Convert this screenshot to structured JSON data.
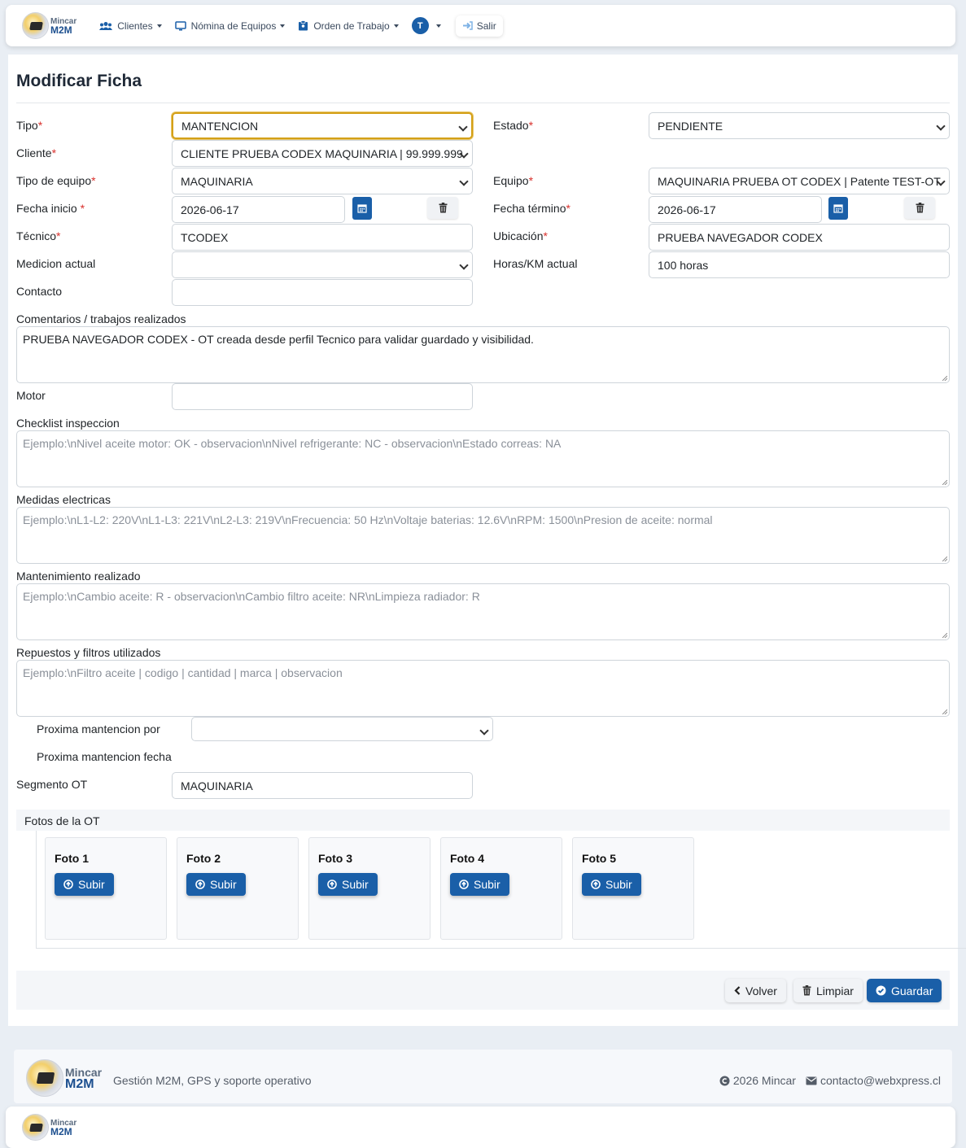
{
  "brand": {
    "line1": "Mincar",
    "line2": "M2M"
  },
  "nav": {
    "clientes": "Clientes",
    "nomina": "Nómina de Equipos",
    "orden": "Orden de Trabajo",
    "user_initial": "T",
    "salir": "Salir"
  },
  "page": {
    "title": "Modificar Ficha"
  },
  "form": {
    "tipo": {
      "label": "Tipo",
      "value": "MANTENCION"
    },
    "estado": {
      "label": "Estado",
      "value": "PENDIENTE"
    },
    "cliente": {
      "label": "Cliente",
      "value": "CLIENTE PRUEBA CODEX MAQUINARIA | 99.999.999"
    },
    "tipo_equipo": {
      "label": "Tipo de equipo",
      "value": "MAQUINARIA"
    },
    "equipo": {
      "label": "Equipo",
      "value": "MAQUINARIA PRUEBA OT CODEX | Patente TEST-OT"
    },
    "fecha_inicio": {
      "label": "Fecha inicio ",
      "value": "2026-06-17"
    },
    "fecha_termino": {
      "label": "Fecha término",
      "value": "2026-06-17"
    },
    "tecnico": {
      "label": "Técnico",
      "value": "TCODEX"
    },
    "ubicacion": {
      "label": "Ubicación",
      "value": "PRUEBA NAVEGADOR CODEX"
    },
    "medicion": {
      "label": "Medicion actual",
      "value": ""
    },
    "horas": {
      "label": "Horas/KM actual",
      "value": "100 horas"
    },
    "contacto": {
      "label": "Contacto",
      "value": ""
    },
    "comentarios": {
      "label": "Comentarios / trabajos realizados",
      "value": "PRUEBA NAVEGADOR CODEX - OT creada desde perfil Tecnico para validar guardado y visibilidad."
    },
    "motor": {
      "label": "Motor",
      "value": ""
    },
    "checklist": {
      "label": "Checklist inspeccion",
      "placeholder": "Ejemplo:\\nNivel aceite motor: OK - observacion\\nNivel refrigerante: NC - observacion\\nEstado correas: NA"
    },
    "medidas": {
      "label": "Medidas electricas",
      "placeholder": "Ejemplo:\\nL1-L2: 220V\\nL1-L3: 221V\\nL2-L3: 219V\\nFrecuencia: 50 Hz\\nVoltaje baterias: 12.6V\\nRPM: 1500\\nPresion de aceite: normal"
    },
    "mantenimiento": {
      "label": "Mantenimiento realizado",
      "placeholder": "Ejemplo:\\nCambio aceite: R - observacion\\nCambio filtro aceite: NR\\nLimpieza radiador: R"
    },
    "repuestos": {
      "label": "Repuestos y filtros utilizados",
      "placeholder": "Ejemplo:\\nFiltro aceite | codigo | cantidad | marca | observacion"
    },
    "proxima_por": {
      "label": "Proxima mantencion por",
      "value": ""
    },
    "proxima_fecha": {
      "label": "Proxima mantencion fecha"
    },
    "segmento": {
      "label": "Segmento OT",
      "value": "MAQUINARIA"
    },
    "required_mark": "*"
  },
  "fotos": {
    "title": "Fotos de la OT",
    "upload_label": "Subir",
    "items": [
      {
        "title": "Foto 1"
      },
      {
        "title": "Foto 2"
      },
      {
        "title": "Foto 3"
      },
      {
        "title": "Foto 4"
      },
      {
        "title": "Foto 5"
      }
    ]
  },
  "actions": {
    "volver": "Volver",
    "limpiar": "Limpiar",
    "guardar": "Guardar"
  },
  "footer": {
    "tagline": "Gestión M2M, GPS y soporte operativo",
    "copyright": "2026 Mincar",
    "email": "contacto@webxpress.cl"
  },
  "colors": {
    "primary": "#1a5fa8",
    "focus": "#d4a017",
    "required": "#d9302c"
  }
}
